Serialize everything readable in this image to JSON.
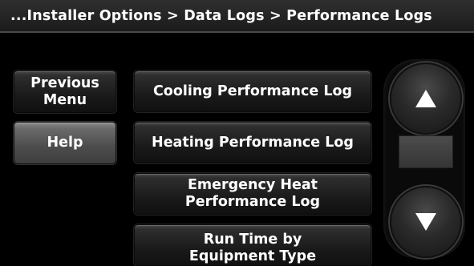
{
  "header": {
    "breadcrumb": "...Installer Options > Data Logs > Performance Logs"
  },
  "left_buttons": {
    "previous_line1": "Previous",
    "previous_line2": "Menu",
    "help": "Help"
  },
  "menu": {
    "items": [
      {
        "line1": "Cooling Performance Log",
        "line2": ""
      },
      {
        "line1": "Heating Performance Log",
        "line2": ""
      },
      {
        "line1": "Emergency Heat",
        "line2": "Performance Log"
      },
      {
        "line1": "Run Time by",
        "line2": "Equipment Type"
      }
    ]
  },
  "scroll": {
    "up_icon": "arrow-up-icon",
    "down_icon": "arrow-down-icon"
  },
  "colors": {
    "background": "#000000",
    "button_dark": "#1a1a1a",
    "button_help": "#6a6a6a",
    "text": "#ffffff"
  }
}
